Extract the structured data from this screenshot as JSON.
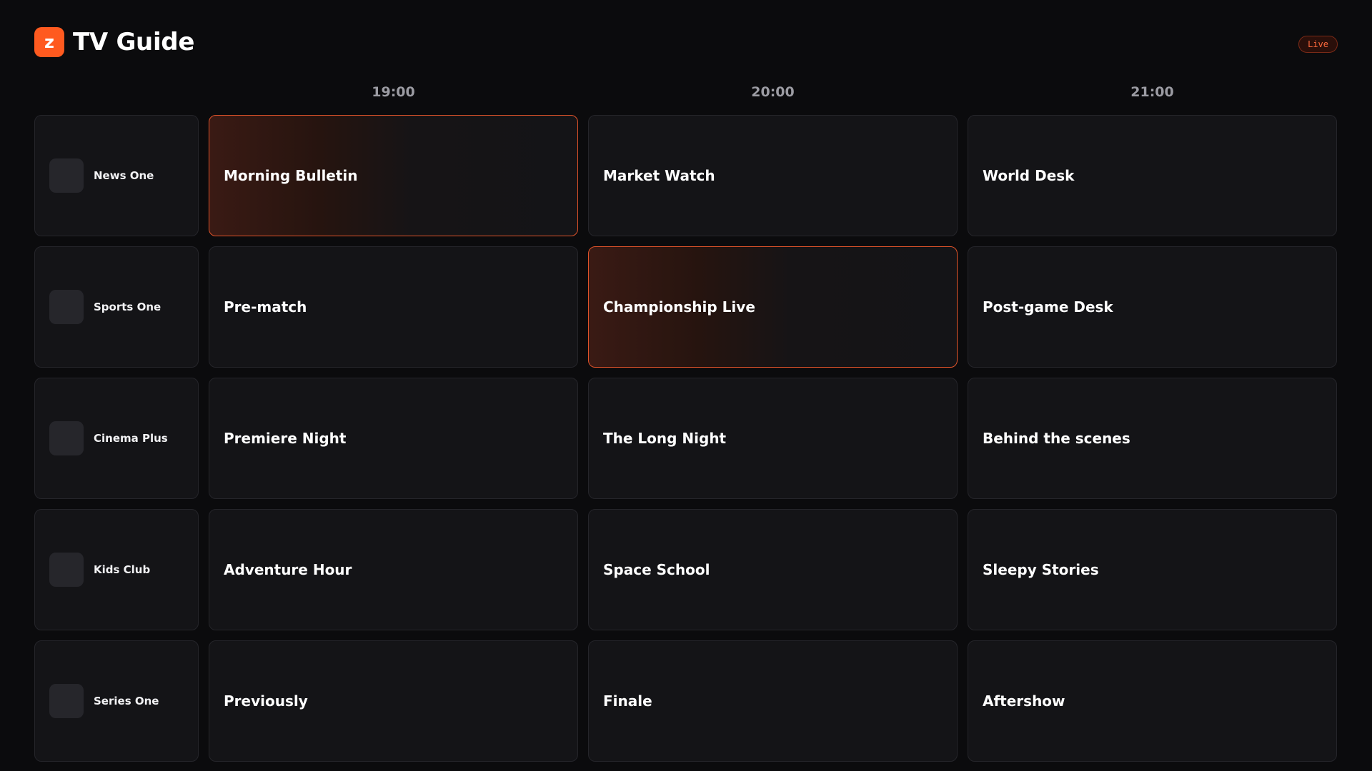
{
  "app": {
    "logo_letter": "z",
    "title": "TV Guide",
    "live_badge": "Live",
    "accent_color": "#ff5a1f"
  },
  "times": [
    "19:00",
    "20:00",
    "21:00"
  ],
  "channels": [
    {
      "name": "News One",
      "programs": [
        {
          "title": "Morning Bulletin",
          "live": true
        },
        {
          "title": "Market Watch",
          "live": false
        },
        {
          "title": "World Desk",
          "live": false
        }
      ]
    },
    {
      "name": "Sports One",
      "programs": [
        {
          "title": "Pre-match",
          "live": false
        },
        {
          "title": "Championship Live",
          "live": true
        },
        {
          "title": "Post-game Desk",
          "live": false
        }
      ]
    },
    {
      "name": "Cinema Plus",
      "programs": [
        {
          "title": "Premiere Night",
          "live": false
        },
        {
          "title": "The Long Night",
          "live": false
        },
        {
          "title": "Behind the scenes",
          "live": false
        }
      ]
    },
    {
      "name": "Kids Club",
      "programs": [
        {
          "title": "Adventure Hour",
          "live": false
        },
        {
          "title": "Space School",
          "live": false
        },
        {
          "title": "Sleepy Stories",
          "live": false
        }
      ]
    },
    {
      "name": "Series One",
      "programs": [
        {
          "title": "Previously",
          "live": false
        },
        {
          "title": "Finale",
          "live": false
        },
        {
          "title": "Aftershow",
          "live": false
        }
      ]
    }
  ]
}
